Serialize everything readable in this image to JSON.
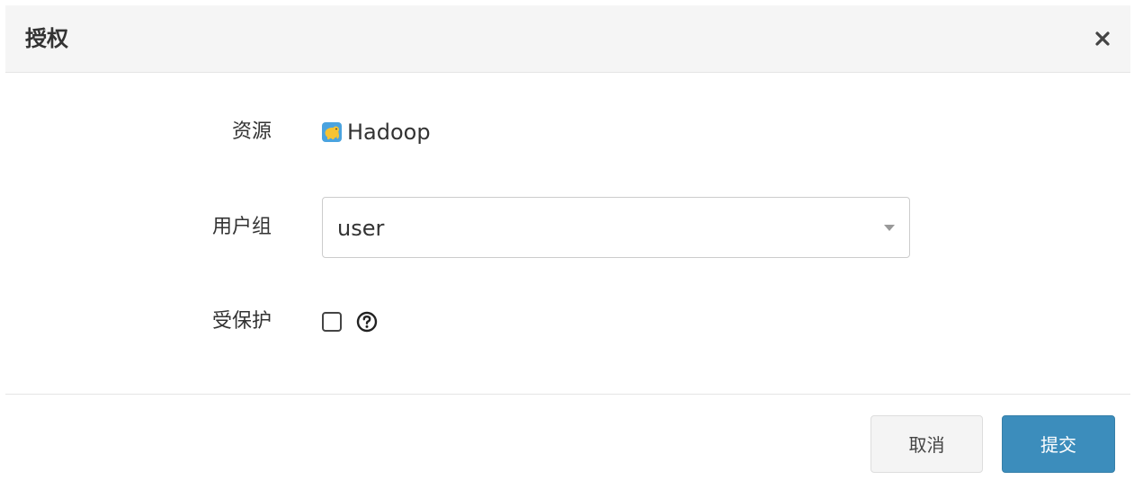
{
  "dialog": {
    "title": "授权",
    "close_icon": "close-icon"
  },
  "form": {
    "resource": {
      "label": "资源",
      "value": "Hadoop",
      "icon": "hadoop-elephant-icon"
    },
    "user_group": {
      "label": "用户组",
      "selected": "user",
      "icon": "chevron-down-icon"
    },
    "protected": {
      "label": "受保护",
      "checked": false,
      "help_icon": "question-circle-icon"
    }
  },
  "footer": {
    "cancel_label": "取消",
    "submit_label": "提交"
  },
  "colors": {
    "header_bg": "#f5f5f5",
    "primary": "#3c8dbc",
    "default_btn": "#f4f4f4"
  }
}
